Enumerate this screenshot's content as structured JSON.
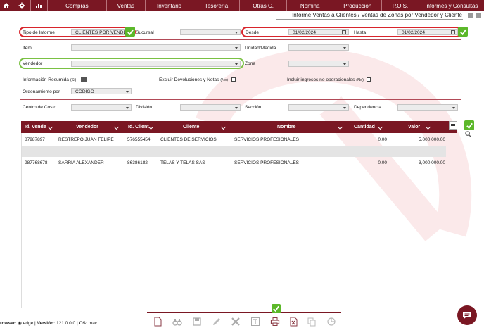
{
  "nav": {
    "items": [
      "Compras",
      "Ventas",
      "Inventario",
      "Tesorería",
      "Otras C.",
      "Nómina",
      "Producción",
      "P.O.S.",
      "Informes y Consultas"
    ],
    "icons": [
      "home-icon",
      "gear-icon",
      "chart-icon"
    ]
  },
  "header": {
    "subtitle": "Informe Ventas a Clientes / Ventas de Zonas por Vendedor y Cliente"
  },
  "filters": {
    "tipo_label": "Tipo de Informe",
    "tipo_value": "CLIENTES POR VENDE",
    "sucursal_label": "Sucursal",
    "desde_label": "Desde",
    "desde_value": "01/02/2024",
    "hasta_label": "Hasta",
    "hasta_value": "01/02/2024",
    "item_label": "Item",
    "unidad_label": "Unidad/Medida",
    "vendedor_label": "Vendedor",
    "zona_label": "Zona",
    "resumida_label": "Información Resumida",
    "resumida_hint": "(Si)",
    "excluir_label": "Excluir Devoluciones y Notas",
    "excluir_hint": "(No)",
    "incluir_label": "Incluir ingresos no operacionales",
    "incluir_hint": "(No)",
    "orden_label": "Ordenamiento por",
    "orden_value": "CÓDIGO",
    "centro_label": "Centro de Costo",
    "division_label": "División",
    "seccion_label": "Sección",
    "dependencia_label": "Dependencia"
  },
  "table": {
    "columns": [
      "Id. Vende",
      "Vendedor",
      "Id. Client",
      "Cliente",
      "Nombre",
      "Cantidad",
      "Valor"
    ],
    "rows": [
      [
        "87987897",
        "RESTREPO  JUAN FELIPE",
        "576555454",
        "CLIENTES DE SERVICIOS",
        "SERVICIOS PROFESIONALES",
        "0.00",
        "5,000,000.00"
      ],
      [
        "987768678",
        "SARRIA  ALEXANDER",
        "86386182",
        "TELAS Y TELAS SAS",
        "SERVICIOS PROFESIONALES",
        "0.00",
        "3,000,000.00"
      ]
    ]
  },
  "footer": {
    "browser_label": "rowser:",
    "browser_value": "edge",
    "version_label": "Versión:",
    "version_value": "121.0.0.0",
    "os_label": "OS:",
    "os_value": "mac"
  },
  "colors": {
    "brand": "#7a1723",
    "highlight_red": "#d8242b",
    "highlight_green": "#7ac143",
    "check_green": "#5cb82a"
  }
}
